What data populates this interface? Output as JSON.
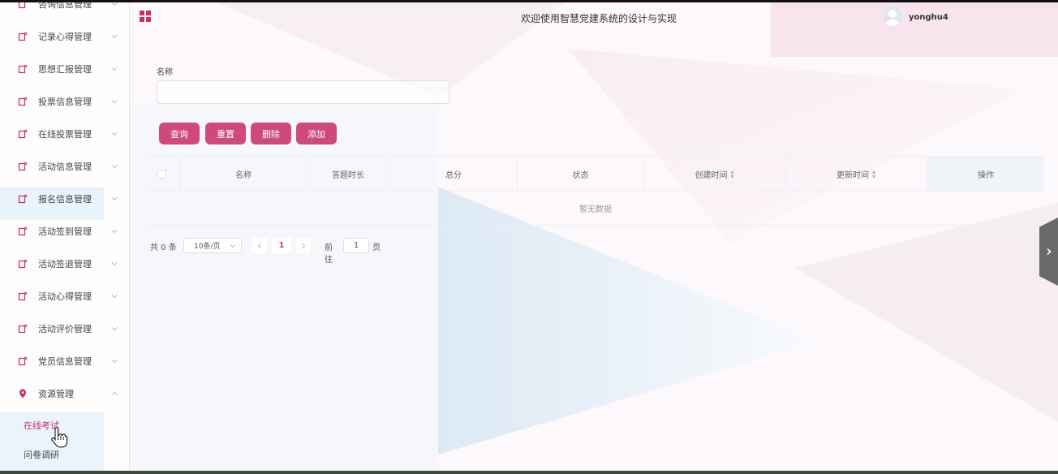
{
  "header": {
    "site_title": "欢迎使用智慧党建系统的设计与实现",
    "username": "yonghu4"
  },
  "sidebar": {
    "partial_top_item": "咨询信息管理",
    "items": [
      {
        "label": "记录心得管理"
      },
      {
        "label": "思想汇报管理"
      },
      {
        "label": "投票信息管理"
      },
      {
        "label": "在线投票管理"
      },
      {
        "label": "活动信息管理"
      },
      {
        "label": "报名信息管理"
      },
      {
        "label": "活动签到管理"
      },
      {
        "label": "活动签退管理"
      },
      {
        "label": "活动心得管理"
      },
      {
        "label": "活动评价管理"
      },
      {
        "label": "党员信息管理"
      },
      {
        "label": "资源管理"
      }
    ],
    "submenu": [
      {
        "label": "在线考试",
        "active": true
      },
      {
        "label": "问卷调研",
        "active": false
      }
    ]
  },
  "search": {
    "name_label": "名称",
    "name_value": ""
  },
  "buttons": {
    "query": "查询",
    "reset": "重置",
    "delete": "删除",
    "add": "添加"
  },
  "table": {
    "columns": [
      "名称",
      "答题时长",
      "总分",
      "状态",
      "创建时间",
      "更新时间",
      "操作"
    ],
    "empty_text": "暂无数据"
  },
  "pagination": {
    "total": "共 0 条",
    "page_size": "10条/页",
    "current_page": "1",
    "goto_label": "前往",
    "goto_value": "1",
    "page_suffix": "页"
  },
  "colors": {
    "accent": "#cd4a7b",
    "active_text": "#c9306a"
  }
}
